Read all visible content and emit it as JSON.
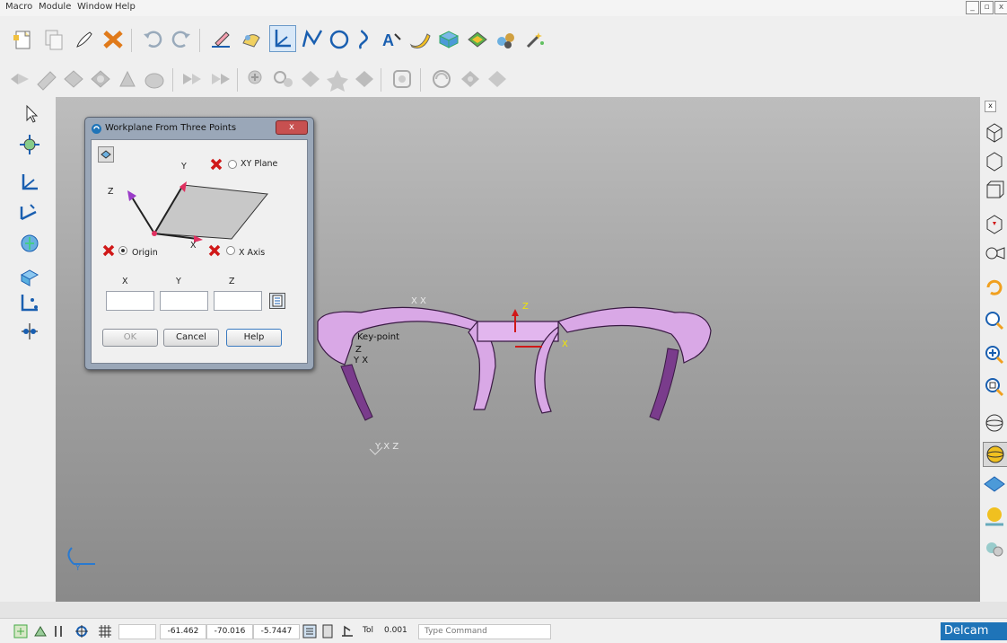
{
  "menu": {
    "items": [
      {
        "label": "Macro"
      },
      {
        "label": "Module"
      },
      {
        "label": "Window"
      },
      {
        "label": "Help"
      }
    ]
  },
  "window_controls": {
    "minimize": "_",
    "restore": "▫",
    "close": "x"
  },
  "colors": {
    "toolbar_bg": "#efefef",
    "viewport_top": "#bdbdbd",
    "viewport_bottom": "#8a8a8a",
    "model": "#d9a8e6",
    "accent_red": "#d01818",
    "brand": "#1f74b8"
  },
  "toolbar_top": {
    "icons": [
      "new-document-icon",
      "copy-icon",
      "brush-icon",
      "delete-icon",
      "undo-icon",
      "redo-icon",
      "edit-pen-icon",
      "probe-icon",
      "workplane-icon",
      "polyline-icon",
      "circle-icon",
      "curve-icon",
      "text-icon",
      "surface-icon",
      "solid-icon",
      "shell-icon",
      "wizard-icon",
      "magic-wand-icon"
    ]
  },
  "toolbar_second": {
    "icons": [
      "nav-arrow-icon",
      "mesh-icon",
      "shape-a-icon",
      "shape-b-icon",
      "shape-c-icon",
      "shape-d-icon",
      "shape-e-icon",
      "align-a-icon",
      "align-b-icon",
      "feature-a-icon",
      "feature-b-icon",
      "feature-c-icon",
      "feature-d-icon",
      "feature-e-icon",
      "rotate-view-icon",
      "sphere-view-icon",
      "extra-view-icon"
    ]
  },
  "left_toolbar": {
    "icons": [
      "select-arrow-icon",
      "move-icon",
      "axis-triad-icon",
      "axis-triad-alt-icon",
      "globe-icon",
      "box-plane-icon",
      "axis-points-icon",
      "snap-points-icon"
    ]
  },
  "right_toolbar": {
    "close_label": "x",
    "icons": [
      "iso-view-icon",
      "top-view-icon",
      "front-view-icon",
      "shade-cube-icon",
      "camera-icon",
      "undo-view-icon",
      "zoom-prev-icon",
      "zoom-in-icon",
      "zoom-box-icon",
      "wire-sphere-icon",
      "shaded-sphere-icon",
      "plane-view-icon",
      "light-ball-icon",
      "material-icon"
    ]
  },
  "dialog": {
    "title": "Workplane From Three Points",
    "close_label": "x",
    "diagram_labels": {
      "y": "Y",
      "z": "Z",
      "x": "X"
    },
    "options": {
      "xy_plane": "XY Plane",
      "origin": "Origin",
      "x_axis": "X Axis"
    },
    "coords": {
      "x": "X",
      "y": "Y",
      "z": "Z"
    },
    "inputs": {
      "x": "",
      "y": "",
      "z": ""
    },
    "buttons": {
      "ok": "OK",
      "cancel": "Cancel",
      "help": "Help"
    }
  },
  "viewport": {
    "keypoint_label": "Key-point",
    "axis_x": "X",
    "axis_y": "Y",
    "axis_z": "Z",
    "xx_label": "X X",
    "yx_label": "Y X",
    "world_triad_label": "Y X Z"
  },
  "status": {
    "coord_x": "-61.462",
    "coord_y": "-70.016",
    "coord_z": "-5.7447",
    "tol_label": "Tol",
    "tol_value": "0.001",
    "command_placeholder": "Type Command",
    "brand": "Delcam"
  }
}
